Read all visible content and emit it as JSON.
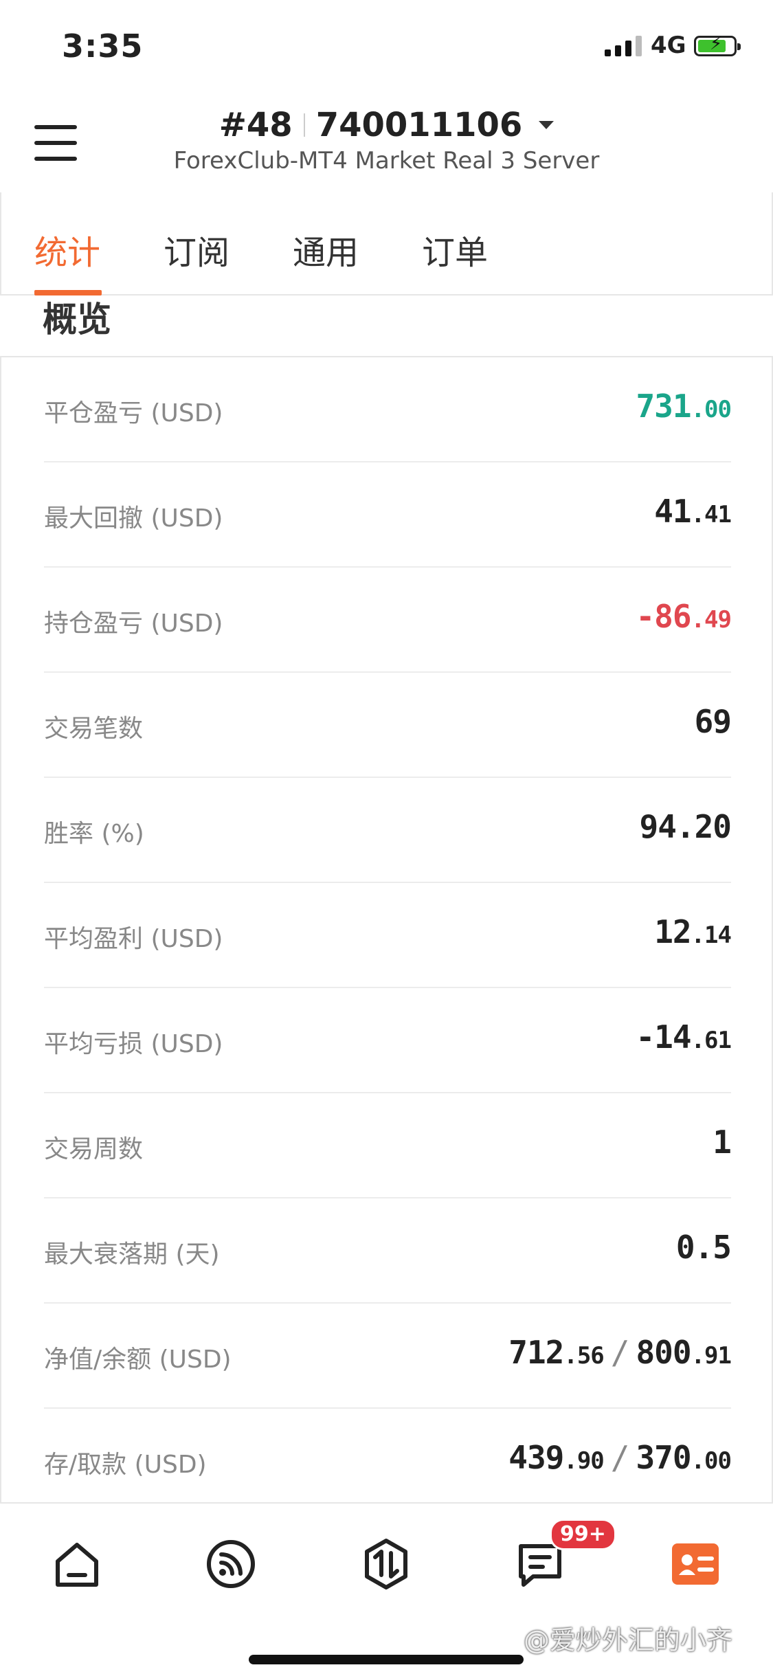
{
  "status_bar": {
    "time": "3:35",
    "network": "4G",
    "icons": [
      "signal-bars-icon",
      "battery-charging-icon"
    ]
  },
  "header": {
    "rank": "#48",
    "account_number": "740011106",
    "server": "ForexClub-MT4 Market Real 3 Server",
    "menu_icon": "hamburger-menu-icon"
  },
  "tabs": [
    {
      "label": "统计",
      "active": true
    },
    {
      "label": "订阅",
      "active": false
    },
    {
      "label": "通用",
      "active": false
    },
    {
      "label": "订单",
      "active": false
    }
  ],
  "overview": {
    "title": "概览",
    "rows": [
      {
        "label": "平仓盈亏 (USD)",
        "int": "731",
        "dec": ".00",
        "color": "#1aa58a"
      },
      {
        "label": "最大回撤 (USD)",
        "int": "41",
        "dec": ".41",
        "color": "#222222"
      },
      {
        "label": "持仓盈亏 (USD)",
        "int": "-86",
        "dec": ".49",
        "color": "#e0474f"
      },
      {
        "label": "交易笔数",
        "int": "69",
        "dec": "",
        "color": "#222222"
      },
      {
        "label": "胜率 (%)",
        "int": "94.20",
        "dec": "",
        "color": "#222222"
      },
      {
        "label": "平均盈利 (USD)",
        "int": "12",
        "dec": ".14",
        "color": "#222222"
      },
      {
        "label": "平均亏损 (USD)",
        "int": "-14",
        "dec": ".61",
        "color": "#222222"
      },
      {
        "label": "交易周数",
        "int": "1",
        "dec": "",
        "color": "#222222"
      },
      {
        "label": "最大衰落期 (天)",
        "int": "0.5",
        "dec": "",
        "color": "#222222"
      },
      {
        "label": "净值/余额 (USD)",
        "int": "712",
        "dec": ".56",
        "int2": "800",
        "dec2": ".91",
        "color": "#222222"
      },
      {
        "label": "存/取款 (USD)",
        "int": "439",
        "dec": ".90",
        "int2": "370",
        "dec2": ".00",
        "color": "#222222"
      }
    ]
  },
  "bottom_nav": {
    "items": [
      "home-icon",
      "feed-icon",
      "trade-icon",
      "message-icon",
      "profile-card-icon"
    ],
    "badge": "99+",
    "accent": "#f26a32"
  },
  "watermark": "@爱炒外汇的小齐"
}
